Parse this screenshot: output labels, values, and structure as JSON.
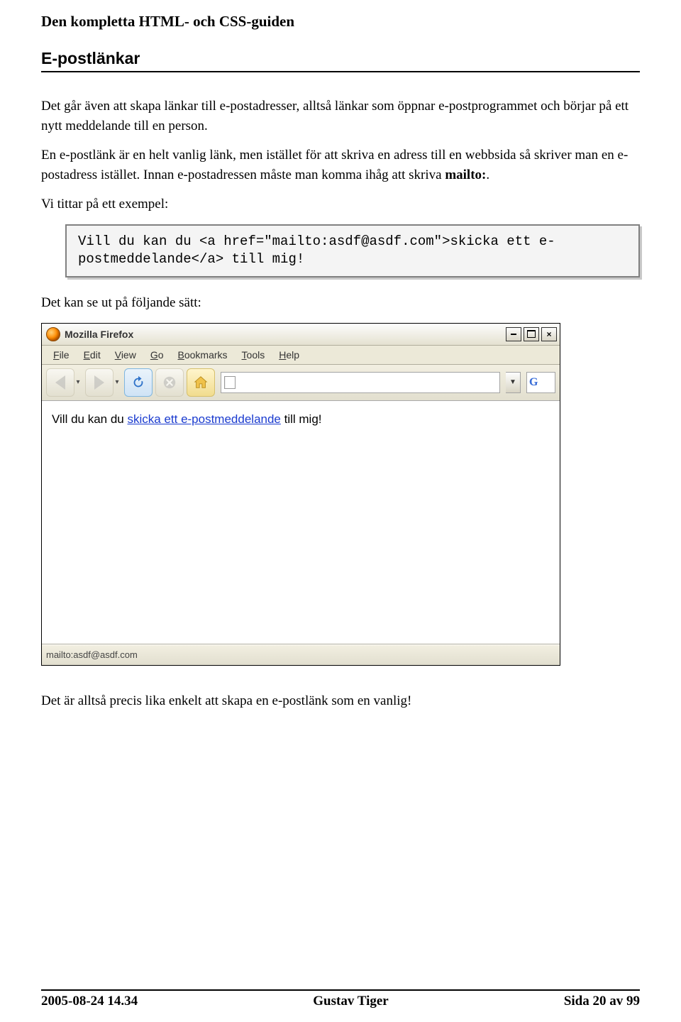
{
  "doc_title": "Den kompletta HTML- och CSS-guiden",
  "section_heading": "E-postlänkar",
  "paragraphs": {
    "p1": "Det går även att skapa länkar till e-postadresser, alltså länkar som öppnar e-postprogrammet och börjar på ett nytt meddelande till en person.",
    "p2_part1": "En e-postlänk är en helt vanlig länk, men istället för att skriva en adress till en webbsida så skriver man en e-postadress istället. Innan e-postadressen måste man komma ihåg att skriva ",
    "p2_mailto": "mailto:",
    "p2_part2": ".",
    "p3": "Vi tittar på ett exempel:",
    "p4": "Det kan se ut på följande sätt:",
    "p5": "Det är alltså precis lika enkelt att skapa en e-postlänk som en vanlig!"
  },
  "code_block": "Vill du kan du <a href=\"mailto:asdf@asdf.com\">skicka ett e-postmeddelande</a> till mig!",
  "browser": {
    "title": "Mozilla Firefox",
    "menus": [
      "File",
      "Edit",
      "View",
      "Go",
      "Bookmarks",
      "Tools",
      "Help"
    ],
    "content_pre": "Vill du kan du ",
    "link_text": "skicka ett e-postmeddelande",
    "content_post": " till mig!",
    "status": "mailto:asdf@asdf.com",
    "search_g": "G"
  },
  "footer": {
    "date": "2005-08-24 14.34",
    "author": "Gustav Tiger",
    "page": "Sida 20 av 99"
  }
}
